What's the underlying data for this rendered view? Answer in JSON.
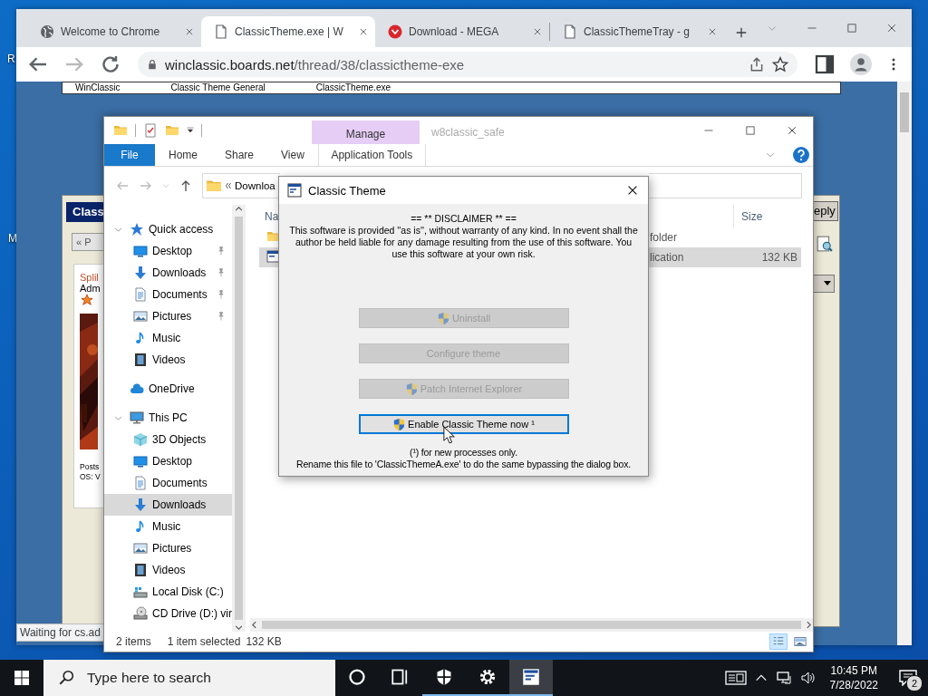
{
  "desktop": {
    "icon_labels": [
      "R",
      "M"
    ]
  },
  "browser": {
    "tabs": [
      {
        "title": "Welcome to Chrome",
        "kind": "globe",
        "selected": false
      },
      {
        "title": "ClassicTheme.exe | W",
        "kind": "page",
        "selected": true
      },
      {
        "title": "Download - MEGA",
        "kind": "mega",
        "selected": false
      },
      {
        "title": "ClassicThemeTray - g",
        "kind": "page",
        "selected": false
      }
    ],
    "url_host": "winclassic.boards.net",
    "url_path": "/thread/38/classictheme-exe",
    "forum_nav": [
      "WinClassic",
      "Classic Theme General",
      "ClassicTheme.exe"
    ],
    "post_panel": {
      "header": "Class",
      "prev_button": "« P",
      "author": "Splil",
      "role": "Adm",
      "posts_label": "Posts",
      "os_label": "OS: V",
      "reply_button": "eply"
    },
    "status": "Waiting for cs.ad"
  },
  "explorer": {
    "title": "w8classic_safe",
    "context_group": "Manage",
    "ribbon_tabs": [
      {
        "label": "File",
        "kind": "file"
      },
      {
        "label": "Home",
        "kind": "plain"
      },
      {
        "label": "Share",
        "kind": "plain"
      },
      {
        "label": "View",
        "kind": "plain"
      },
      {
        "label": "Application Tools",
        "kind": "contextual"
      }
    ],
    "address": "Downloa",
    "nav_tree": [
      {
        "label": "Quick access",
        "kind": "star",
        "expanded": true,
        "selected": false,
        "children": [
          {
            "label": "Desktop",
            "kind": "desktop",
            "pinned": true,
            "selected": false
          },
          {
            "label": "Downloads",
            "kind": "download",
            "pinned": true,
            "selected": false
          },
          {
            "label": "Documents",
            "kind": "document",
            "pinned": true,
            "selected": false
          },
          {
            "label": "Pictures",
            "kind": "picture",
            "pinned": true,
            "selected": false
          },
          {
            "label": "Music",
            "kind": "music",
            "pinned": false,
            "selected": false
          },
          {
            "label": "Videos",
            "kind": "video",
            "pinned": false,
            "selected": false
          }
        ]
      },
      {
        "label": "OneDrive",
        "kind": "cloud",
        "expanded": false,
        "selected": false
      },
      {
        "label": "This PC",
        "kind": "pc",
        "expanded": true,
        "selected": false,
        "children": [
          {
            "label": "3D Objects",
            "kind": "cube",
            "selected": false
          },
          {
            "label": "Desktop",
            "kind": "desktop",
            "selected": false
          },
          {
            "label": "Documents",
            "kind": "document",
            "selected": false
          },
          {
            "label": "Downloads",
            "kind": "download",
            "selected": true
          },
          {
            "label": "Music",
            "kind": "music",
            "selected": false
          },
          {
            "label": "Pictures",
            "kind": "picture",
            "selected": false
          },
          {
            "label": "Videos",
            "kind": "video",
            "selected": false
          },
          {
            "label": "Local Disk (C:)",
            "kind": "disk",
            "selected": false
          },
          {
            "label": "CD Drive (D:) vir",
            "kind": "cd",
            "selected": false
          }
        ]
      }
    ],
    "name_column": "Na",
    "size_column": "Size",
    "files": [
      {
        "kind": "folder",
        "type": "folder",
        "selected": false
      },
      {
        "kind": "app",
        "type": "lication",
        "size": "132 KB",
        "selected": true
      }
    ],
    "status": {
      "items": "2 items",
      "selection": "1 item selected",
      "size": "132 KB"
    },
    "views": [
      {
        "kind": "details",
        "selected": true
      },
      {
        "kind": "large_icons",
        "selected": false
      }
    ]
  },
  "dialog": {
    "title": "Classic Theme",
    "disclaimer_title": "== ** DISCLAIMER ** ==",
    "disclaimer": "This software is provided ''as is'', without warranty of any kind. In no event shall the author be held liable for any damage resulting from the use of this software. You use this software at your own risk.",
    "buttons": [
      {
        "label": "Uninstall",
        "shield": true,
        "disabled": true,
        "focused": false
      },
      {
        "label": "Configure theme",
        "shield": false,
        "disabled": true,
        "focused": false
      },
      {
        "label": "Patch Internet Explorer",
        "shield": true,
        "disabled": true,
        "focused": false
      },
      {
        "label": "Enable Classic Theme now ¹",
        "shield": true,
        "disabled": false,
        "focused": true
      }
    ],
    "footnote": "(¹) for new processes only.",
    "note": "Rename this file to 'ClassicThemeA.exe' to do the same bypassing the dialog box."
  },
  "taskbar": {
    "search_placeholder": "Type here to search",
    "apps": [
      {
        "kind": "cortana",
        "running": false,
        "selected": false
      },
      {
        "kind": "task_view",
        "running": false,
        "selected": false
      },
      {
        "kind": "security",
        "running": true,
        "selected": false
      },
      {
        "kind": "settings",
        "running": true,
        "selected": false
      },
      {
        "kind": "app_window",
        "running": true,
        "selected": true
      }
    ],
    "time": "10:45 PM",
    "date": "7/28/2022",
    "notifications": "2"
  }
}
